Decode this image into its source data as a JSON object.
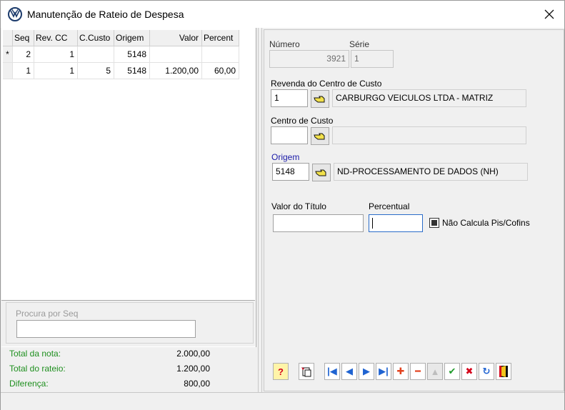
{
  "window": {
    "title": "Manutenção de Rateio de Despesa"
  },
  "grid": {
    "columns": [
      "Seq",
      "Rev. CC",
      "C.Custo",
      "Origem",
      "Valor",
      "Percent"
    ],
    "rows": [
      {
        "indicator": "*",
        "seq": "2",
        "rev_cc": "1",
        "c_custo": "",
        "origem": "5148",
        "valor": "",
        "percent": ""
      },
      {
        "indicator": "",
        "seq": "1",
        "rev_cc": "1",
        "c_custo": "5",
        "origem": "5148",
        "valor": "1.200,00",
        "percent": "60,00"
      }
    ]
  },
  "search": {
    "label": "Procura por Seq",
    "value": ""
  },
  "totals": {
    "total_nota_label": "Total da nota:",
    "total_nota_value": "2.000,00",
    "total_rateio_label": "Total do rateio:",
    "total_rateio_value": "1.200,00",
    "diferenca_label": "Diferença:",
    "diferenca_value": "800,00"
  },
  "form": {
    "numero_label": "Número",
    "numero_value": "3921",
    "serie_label": "Série",
    "serie_value": "1",
    "revenda_label": "Revenda do Centro de Custo",
    "revenda_code": "1",
    "revenda_desc": "CARBURGO VEICULOS LTDA - MATRIZ",
    "centro_label": "Centro de Custo",
    "centro_code": "",
    "centro_desc": "",
    "origem_label": "Origem",
    "origem_code": "5148",
    "origem_desc": "ND-PROCESSAMENTO DE DADOS (NH)",
    "valor_titulo_label": "Valor do Título",
    "valor_titulo_value": "",
    "percentual_label": "Percentual",
    "percentual_value": "",
    "nao_calcula_label": "Não Calcula Pis/Cofins"
  },
  "colors": {
    "totals_label": "#1e8f1e",
    "origem_label": "#1a1aa8",
    "focus_border": "#2a6cc9"
  },
  "toolbar": [
    "help-icon",
    "copy-document-icon",
    "first-record-icon",
    "previous-record-icon",
    "next-record-icon",
    "last-record-icon",
    "add-icon",
    "remove-icon",
    "up-disabled-icon",
    "confirm-icon",
    "cancel-icon",
    "refresh-icon",
    "exit-door-icon"
  ]
}
